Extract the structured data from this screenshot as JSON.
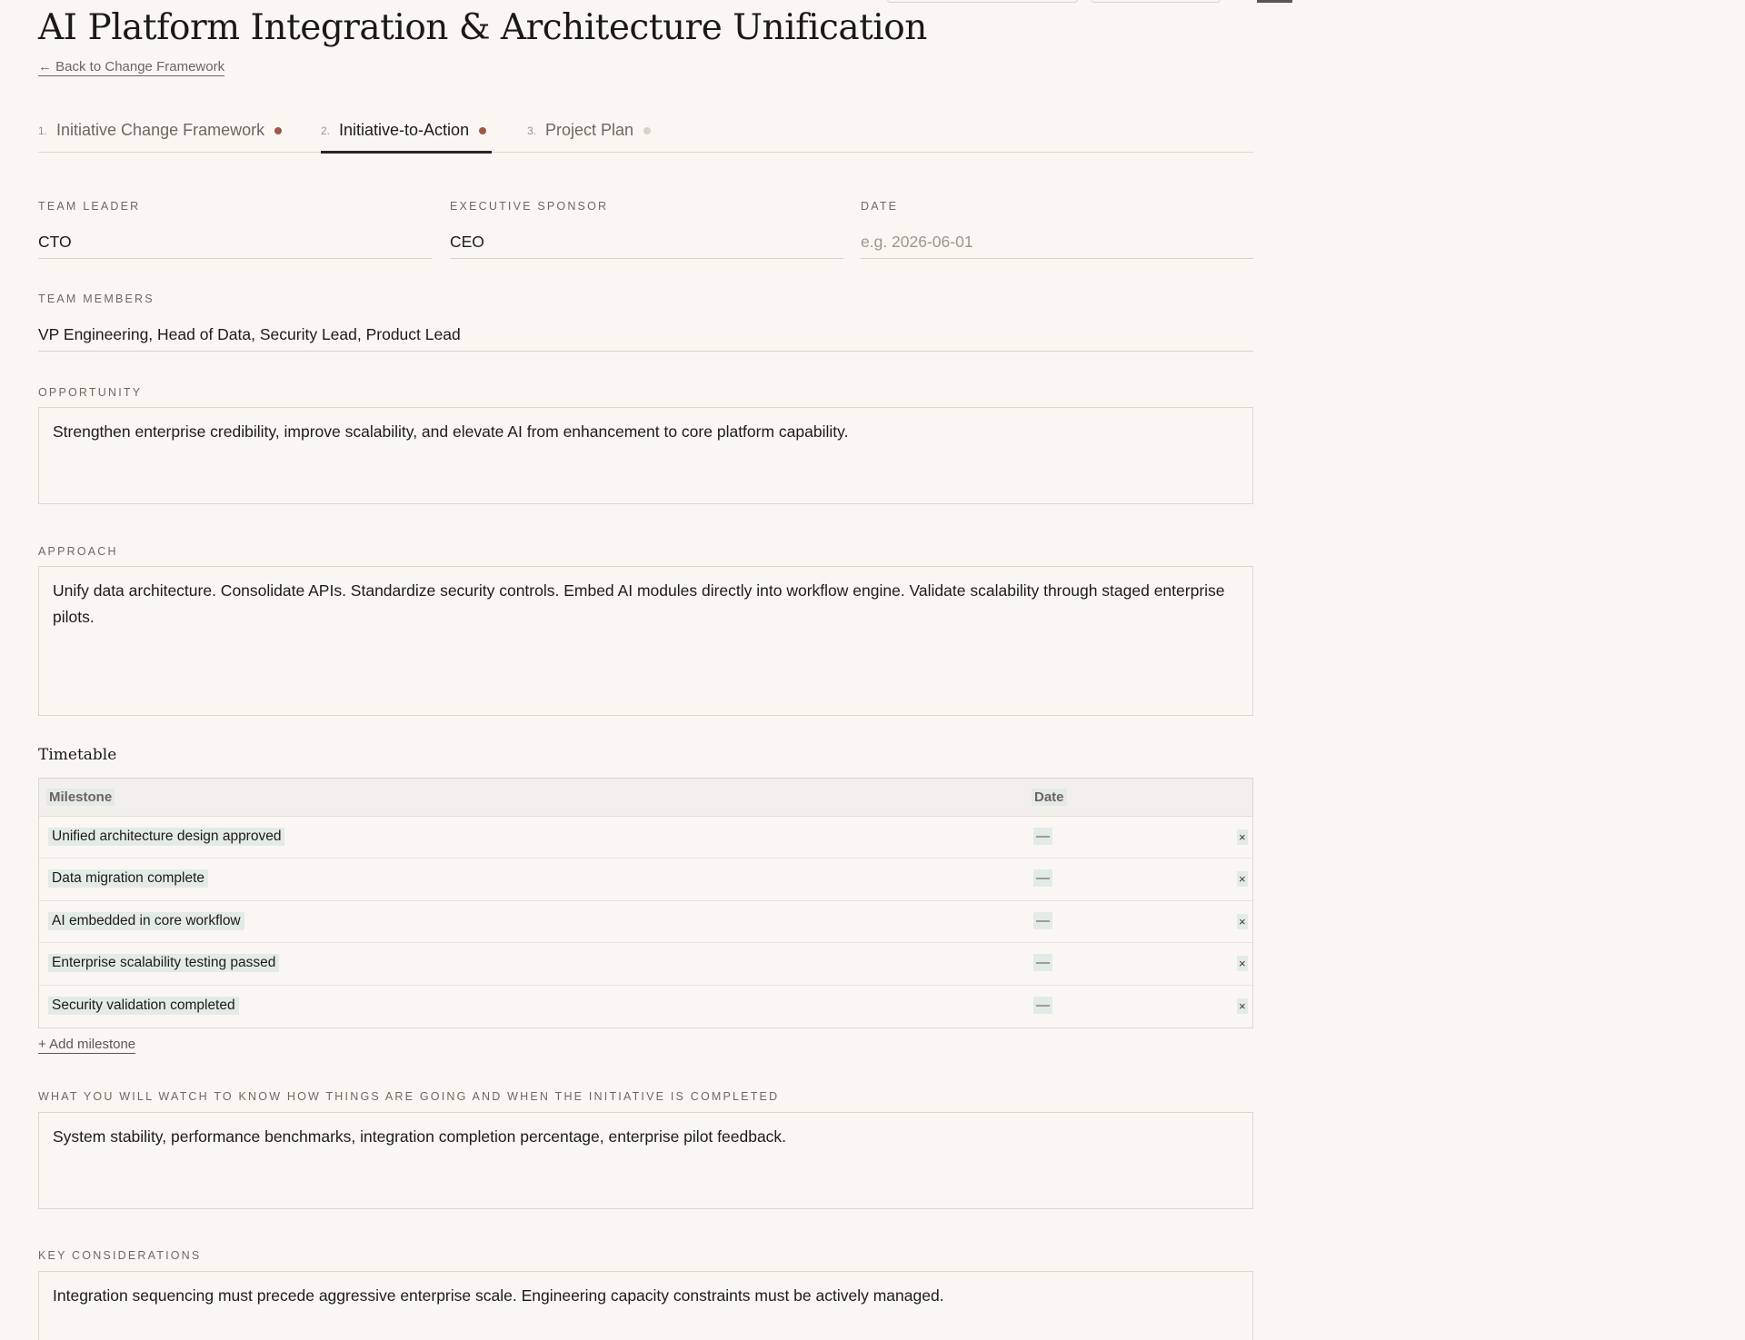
{
  "page": {
    "title": "AI Platform Integration & Architecture Unification",
    "back_link": "← Back to Change Framework"
  },
  "tabs": [
    {
      "number": "1.",
      "label": "Initiative Change Framework",
      "dot_color": "#a0574a",
      "active": false
    },
    {
      "number": "2.",
      "label": "Initiative-to-Action",
      "dot_color": "#a0574a",
      "active": true
    },
    {
      "number": "3.",
      "label": "Project Plan",
      "dot_color": "#d8d2cb",
      "active": false
    }
  ],
  "fields": {
    "team_leader": {
      "label": "Team Leader",
      "value": "CTO"
    },
    "executive_sponsor": {
      "label": "Executive Sponsor",
      "value": "CEO"
    },
    "date": {
      "label": "Date",
      "value": "",
      "placeholder": "e.g. 2026-06-01"
    },
    "team_members": {
      "label": "Team Members",
      "value": "VP Engineering, Head of Data, Security Lead, Product Lead"
    },
    "opportunity": {
      "label": "Opportunity",
      "value": "Strengthen enterprise credibility, improve scalability, and elevate AI from enhancement to core platform capability."
    },
    "approach": {
      "label": "Approach",
      "value": "Unify data architecture. Consolidate APIs. Standardize security controls. Embed AI modules directly into workflow engine. Validate scalability through staged enterprise pilots."
    },
    "watch": {
      "label": "What you will watch to know how things are going and when the initiative is completed",
      "value": "System stability, performance benchmarks, integration completion percentage, enterprise pilot feedback."
    },
    "key_considerations": {
      "label": "Key Considerations",
      "value": "Integration sequencing must precede aggressive enterprise scale. Engineering capacity constraints must be actively managed."
    }
  },
  "timetable": {
    "title": "Timetable",
    "headers": {
      "milestone": "Milestone",
      "date": "Date"
    },
    "rows": [
      {
        "milestone": "Unified architecture design approved",
        "date": "—",
        "remove": "×"
      },
      {
        "milestone": "Data migration complete",
        "date": "—",
        "remove": "×"
      },
      {
        "milestone": "AI embedded in core workflow",
        "date": "—",
        "remove": "×"
      },
      {
        "milestone": "Enterprise scalability testing passed",
        "date": "—",
        "remove": "×"
      },
      {
        "milestone": "Security validation completed",
        "date": "—",
        "remove": "×"
      }
    ],
    "add_label": "+ Add milestone"
  }
}
